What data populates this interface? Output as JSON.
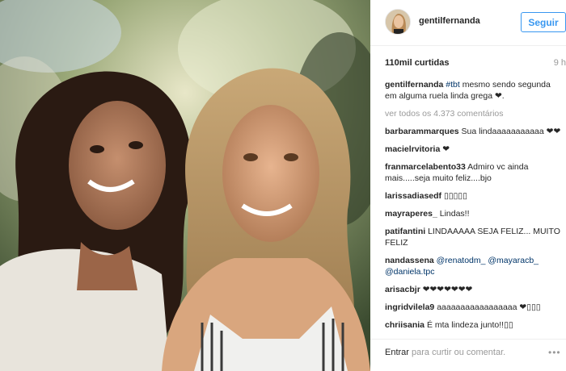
{
  "post": {
    "username": "gentilfernanda",
    "follow_label": "Seguir",
    "likes": "110mil curtidas",
    "time": "9 h",
    "caption_user": "gentilfernanda",
    "caption_tag": "#tbt",
    "caption_text": " mesmo sendo segunda em alguma ruela linda grega ❤.",
    "view_all": "ver todos os 4.373 comentários"
  },
  "comments": [
    {
      "user": "barbarammarques",
      "text": " Sua lindaaaaaaaaaaa ❤❤"
    },
    {
      "user": "macielrvitoria",
      "text": " ❤"
    },
    {
      "user": "franmarcelabento33",
      "text": " Admiro vc ainda mais.....seja muito feliz....bjo"
    },
    {
      "user": "larissadiasedf",
      "text": " ▯▯▯▯▯"
    },
    {
      "user": "mayraperes_",
      "text": " Lindas!!"
    },
    {
      "user": "patifantini",
      "text": " LINDAAAAA SEJA FELIZ... MUITO FELIZ"
    },
    {
      "user": "nandassena",
      "mention1": " @renatodm_",
      "mention2": " @mayaracb_",
      "mention3": " @daniela.tpc"
    },
    {
      "user": "arisacbjr",
      "text": " ❤❤❤❤❤❤❤"
    },
    {
      "user": "ingridvilela9",
      "text": " aaaaaaaaaaaaaaaaa ❤▯▯▯"
    },
    {
      "user": "chriisania",
      "text": " É mta lindeza junto!!▯▯"
    }
  ],
  "footer": {
    "enter": "Entrar",
    "rest": " para curtir ou comentar.",
    "more": "•••"
  },
  "icons": {
    "more": "more-options-icon",
    "avatar": "profile-avatar"
  }
}
